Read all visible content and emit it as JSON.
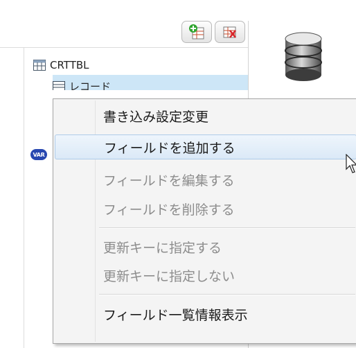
{
  "toolbar": {
    "add_icon": "add-table-icon",
    "delete_icon": "delete-table-icon"
  },
  "tree": {
    "items": [
      {
        "label": "CRTTBL",
        "icon": "table-icon"
      },
      {
        "label": "レコード",
        "icon": "record-icon",
        "selected": true
      }
    ],
    "var_badge": "VAR"
  },
  "context_menu": {
    "items": [
      {
        "label": "書き込み設定変更",
        "enabled": true
      },
      {
        "label": "フィールドを追加する",
        "enabled": true,
        "hovered": true
      },
      {
        "label": "フィールドを編集する",
        "enabled": false
      },
      {
        "label": "フィールドを削除する",
        "enabled": false
      },
      {
        "label": "更新キーに指定する",
        "enabled": false
      },
      {
        "label": "更新キーに指定しない",
        "enabled": false
      },
      {
        "label": "フィールド一覧情報表示",
        "enabled": true
      }
    ]
  },
  "colors": {
    "selection": "#cde6f7",
    "menu_bg": "#f4f4f4",
    "hover_bg": "#dbe9f7",
    "disabled_text": "#8c8c8c",
    "var_badge": "#2747b0"
  }
}
